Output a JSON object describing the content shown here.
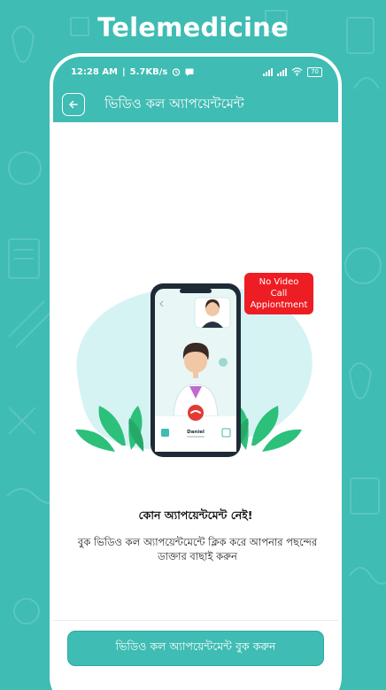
{
  "promo": {
    "title": "Telemedicine"
  },
  "status_bar": {
    "time": "12:28 AM",
    "speed": "5.7KB/s",
    "battery": "70"
  },
  "app_bar": {
    "title": "ভিডিও কল অ্যাপয়েন্টমেন্ট",
    "back_icon": "arrow-left-icon"
  },
  "empty_state": {
    "badge": "No Video Call Appiontment",
    "callee_name": "Daniel",
    "heading": "কোন অ্যাপয়েন্টমেন্ট নেই!",
    "description": "বুক ভিডিও কল অ্যাপয়েন্টমেন্টে ক্লিক করে আপনার পছন্দের ডাক্তার বাছাই করুন"
  },
  "cta": {
    "label": "ভিডিও কল অ্যাপয়েন্টমেন্ট বুক করুন"
  },
  "colors": {
    "brand": "#3fbcb3",
    "badge_red": "#ee1d23",
    "call_end_red": "#e53935",
    "leaf_green": "#2cc07a"
  }
}
